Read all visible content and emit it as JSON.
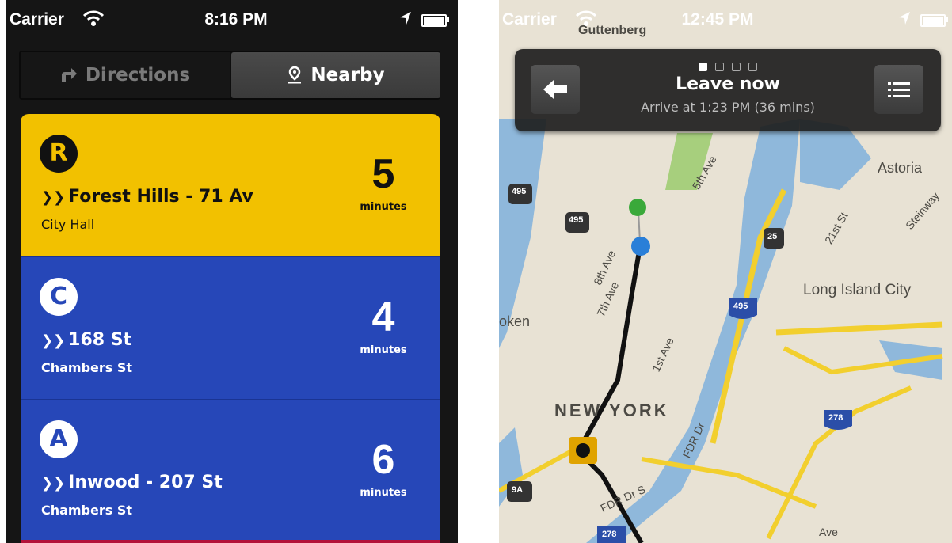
{
  "left_screen": {
    "status": {
      "carrier": "Carrier",
      "time": "8:16 PM"
    },
    "tabs": [
      {
        "label": "Directions",
        "active": false
      },
      {
        "label": "Nearby",
        "active": true
      }
    ],
    "trains": [
      {
        "line": "R",
        "destination": "Forest Hills - 71 Av",
        "station": "City Hall",
        "minutes": "5",
        "minutes_label": "minutes",
        "color": "#f2c100"
      },
      {
        "line": "C",
        "destination": "168 St",
        "station": "Chambers St",
        "minutes": "4",
        "minutes_label": "minutes",
        "color": "#2647b8"
      },
      {
        "line": "A",
        "destination": "Inwood - 207 St",
        "station": "Chambers St",
        "minutes": "6",
        "minutes_label": "minutes",
        "color": "#2647b8"
      }
    ]
  },
  "right_screen": {
    "status": {
      "carrier": "Carrier",
      "time": "12:45 PM"
    },
    "nav": {
      "title": "Leave now",
      "subtitle": "Arrive at 1:23 PM (36 mins)"
    },
    "map_labels": {
      "guttenberg": "Guttenberg",
      "astoria": "Astoria",
      "long_island_city": "Long Island City",
      "new_york": "NEW YORK",
      "oken": "oken",
      "fifth_ave": "5th Ave",
      "eighth_ave": "8th Ave",
      "seventh_ave": "7th Ave",
      "first_ave": "1st Ave",
      "twentyfirst_st": "21st St",
      "steinway": "Steinway",
      "fdr_dr": "FDR Dr",
      "fdr_dr_s": "FDR Dr S",
      "ave": "Ave"
    },
    "shields": [
      "495",
      "495",
      "25",
      "495",
      "278",
      "9A",
      "278"
    ],
    "colors": {
      "water": "#8fb8db",
      "land": "#e8e2d4",
      "highway": "#f2cf2e",
      "park": "#a7cf7d",
      "route": "#111111"
    }
  }
}
